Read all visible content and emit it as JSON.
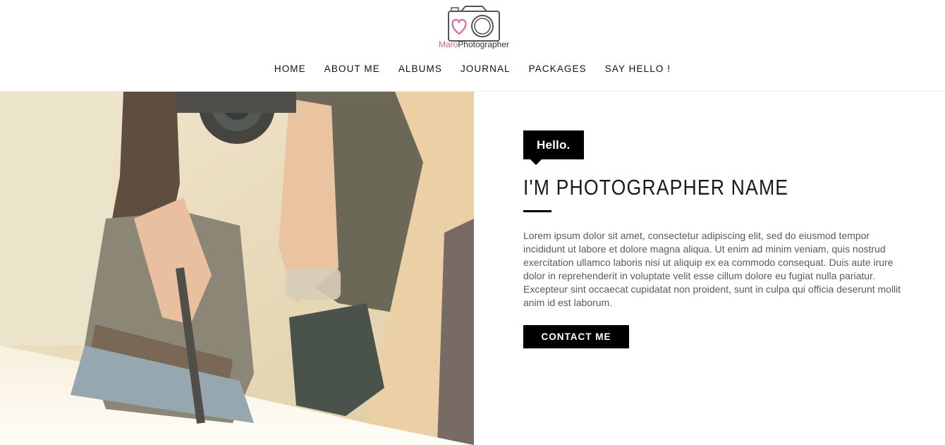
{
  "brand": {
    "name_part1": "Maro",
    "name_part2": "Photographer",
    "accent_color": "#e75a94"
  },
  "nav": {
    "items": [
      {
        "label": "HOME"
      },
      {
        "label": "ABOUT ME"
      },
      {
        "label": "ALBUMS"
      },
      {
        "label": "JOURNAL"
      },
      {
        "label": "PACKAGES"
      },
      {
        "label": "SAY HELLO !"
      }
    ]
  },
  "hero": {
    "photo_icon": "photographer-photo",
    "tag": "Hello.",
    "title": "I'M PHOTOGRAPHER NAME",
    "body": "Lorem ipsum dolor sit amet, consectetur adipiscing elit, sed do eiusmod tempor incididunt ut labore et dolore magna aliqua. Ut enim ad minim veniam, quis nostrud exercitation ullamco laboris nisi ut aliquip ex ea commodo consequat. Duis aute irure dolor in reprehenderit in voluptate velit esse cillum dolore eu fugiat nulla pariatur. Excepteur sint occaecat cupidatat non proident, sunt in culpa qui officia deserunt mollit anim id est laborum.",
    "cta_label": "CONTACT ME"
  }
}
